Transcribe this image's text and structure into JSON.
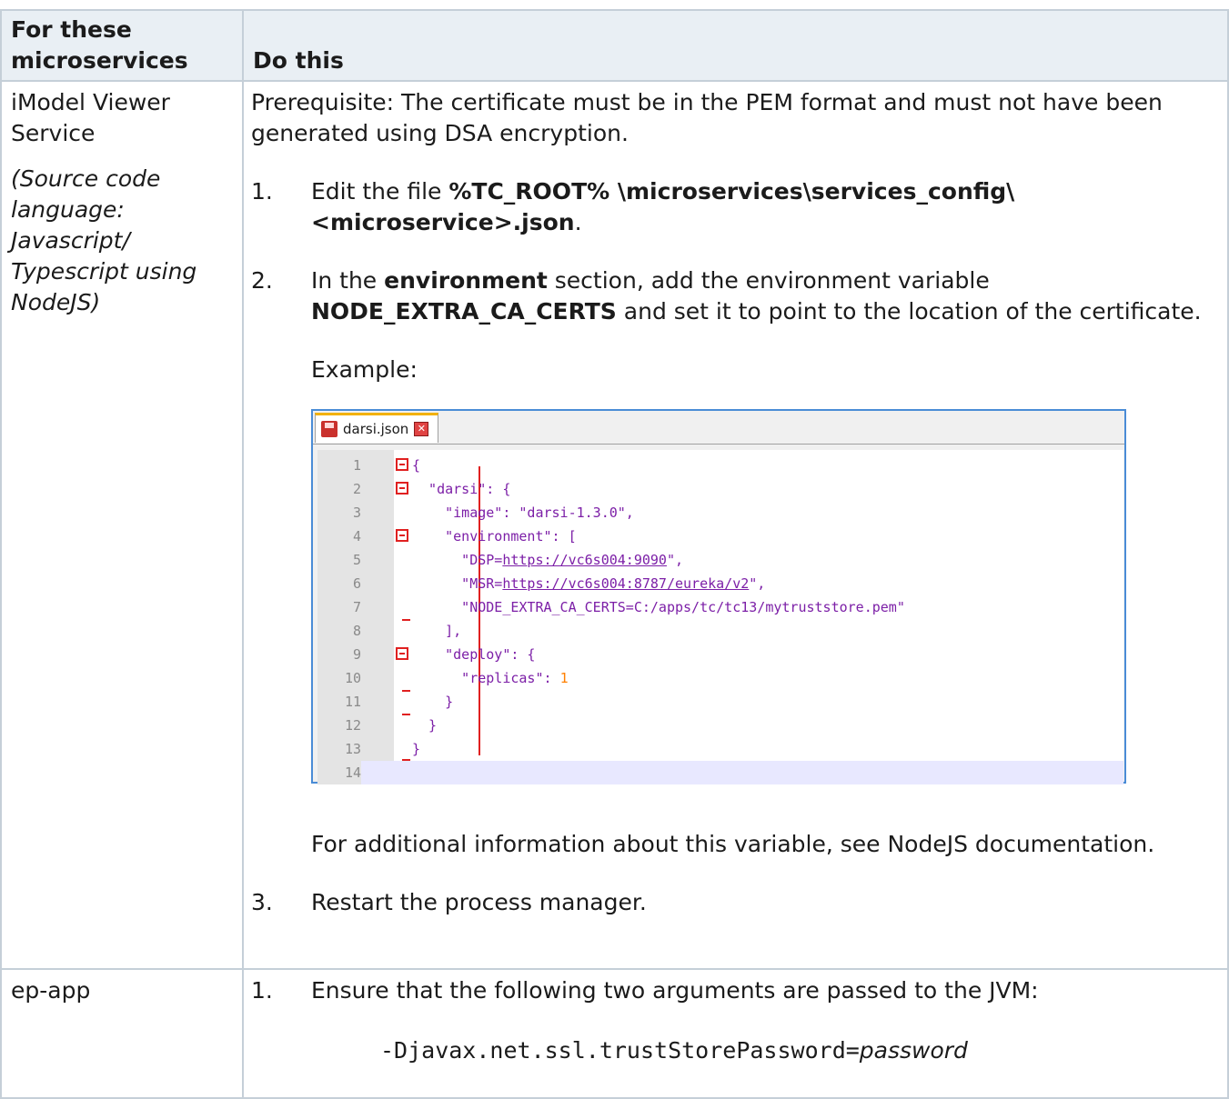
{
  "table": {
    "headers": [
      "For these microservices",
      "Do this"
    ],
    "rows": [
      {
        "service": "iModel Viewer Service",
        "service_note": "(Source code language: Javascript/ Typescript using NodeJS)",
        "prereq": "Prerequisite: The certificate must be in the PEM format and must not have been generated using DSA encryption.",
        "step1": {
          "num": "1.",
          "pre": "Edit the file ",
          "bold": "%TC_ROOT% \\microservices\\services_config\\<microservice>.json",
          "post": "."
        },
        "step2": {
          "num": "2.",
          "pre": "In the ",
          "bold1": "environment",
          "mid": " section, add the environment variable ",
          "bold2": "NODE_EXTRA_CA_CERTS",
          "post": " and set it to point to the location of the certificate."
        },
        "example_label": "Example:",
        "after_example": "For additional information about this variable, see NodeJS documentation.",
        "step3": {
          "num": "3.",
          "text": "Restart the process manager."
        }
      },
      {
        "service": "ep-app",
        "step1": {
          "num": "1.",
          "text": "Ensure that the following two arguments are passed to the JVM:"
        },
        "arg_prefix": "-Djavax.net.ssl.trustStorePassword=",
        "arg_value": "password"
      }
    ]
  },
  "editor": {
    "tab_label": "darsi.json",
    "line_numbers": [
      "1",
      "2",
      "3",
      "4",
      "5",
      "6",
      "7",
      "8",
      "9",
      "10",
      "11",
      "12",
      "13",
      "14"
    ],
    "code": {
      "l1": "{",
      "l2": "  \"darsi\": {",
      "l3": "    \"image\": \"darsi-1.3.0\",",
      "l4": "    \"environment\": [",
      "l5_a": "      \"DSP=",
      "l5_link": "https://vc6s004:9090",
      "l5_b": "\",",
      "l6_a": "      \"MSR=",
      "l6_link": "https://vc6s004:8787/eureka/v2",
      "l6_b": "\",",
      "l7": "      \"NODE_EXTRA_CA_CERTS=C:/apps/tc/tc13/mytruststore.pem\"",
      "l8": "    ],",
      "l9": "    \"deploy\": {",
      "l10_a": "      \"replicas\": ",
      "l10_num": "1",
      "l11": "    }",
      "l12": "  }",
      "l13": "}",
      "l14": ""
    }
  }
}
